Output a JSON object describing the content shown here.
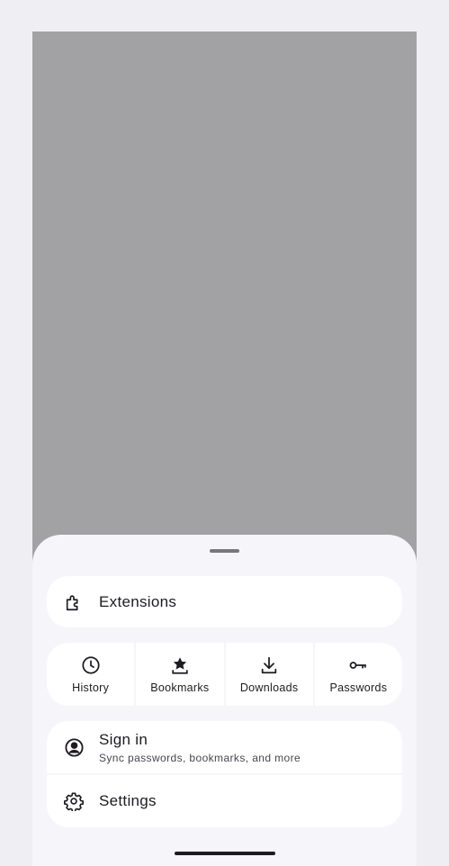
{
  "menu": {
    "extensions": {
      "label": "Extensions",
      "icon": "puzzle-icon"
    },
    "quick_actions": [
      {
        "label": "History",
        "icon": "clock-icon"
      },
      {
        "label": "Bookmarks",
        "icon": "bookmark-star-icon"
      },
      {
        "label": "Downloads",
        "icon": "download-icon"
      },
      {
        "label": "Passwords",
        "icon": "key-icon"
      }
    ],
    "account": {
      "sign_in_label": "Sign in",
      "sign_in_sub": "Sync passwords, bookmarks, and more",
      "sign_in_icon": "account-circle-icon",
      "settings_label": "Settings",
      "settings_icon": "gear-icon"
    }
  },
  "colors": {
    "page_bg": "#efeef3",
    "scrim": "#a2a2a4",
    "sheet_bg": "#f6f5fa",
    "card_bg": "#ffffff",
    "text": "#1d1b20"
  }
}
